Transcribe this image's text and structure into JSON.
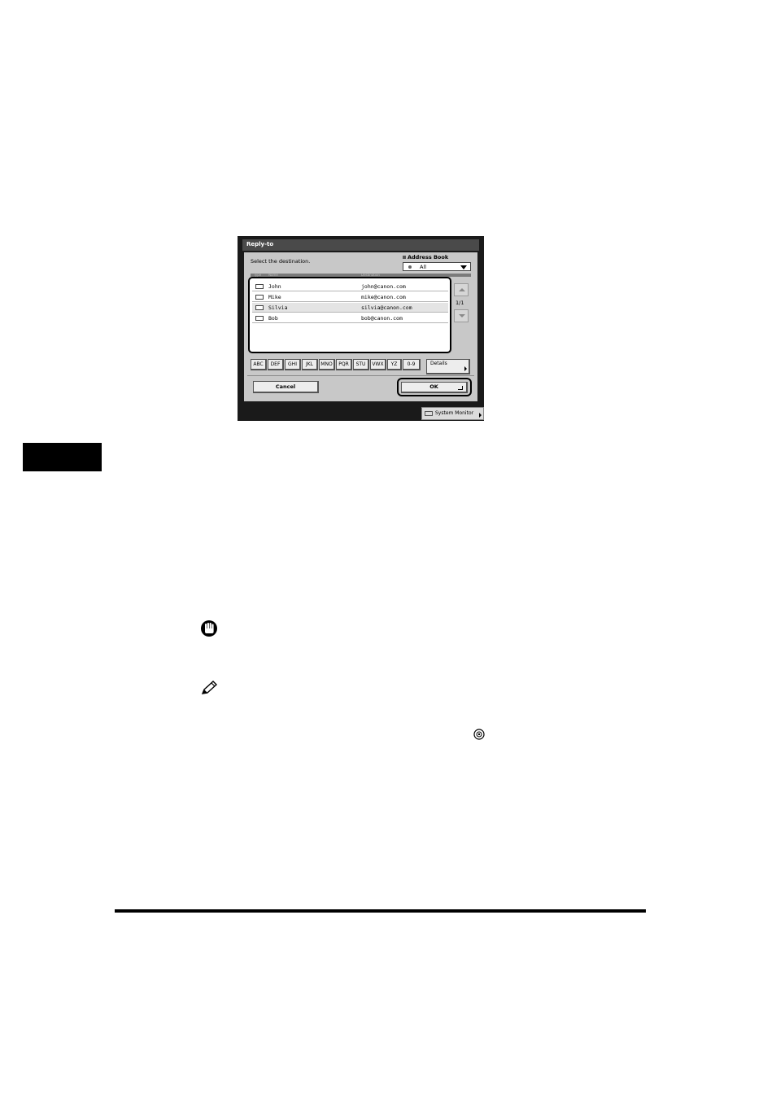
{
  "dialog": {
    "title": "Reply-to",
    "instruction": "Select the destination.",
    "address_book": {
      "label": "Address Book",
      "selected": "All"
    },
    "columns": {
      "type": "Type",
      "name": "Name",
      "destination": "Destination"
    },
    "entries": [
      {
        "name": "John",
        "address": "john@canon.com"
      },
      {
        "name": "Mike",
        "address": "mike@canon.com"
      },
      {
        "name": "Silvia",
        "address": "silvia@canon.com"
      },
      {
        "name": "Bob",
        "address": "bob@canon.com"
      }
    ],
    "page_indicator": "1/1",
    "alpha_buttons": [
      "ABC",
      "DEF",
      "GHI",
      "JKL",
      "MNO",
      "PQR",
      "STU",
      "VWX",
      "YZ",
      "0-9"
    ],
    "details_label": "Details",
    "cancel_label": "Cancel",
    "ok_label": "OK"
  },
  "footer": {
    "system_monitor_label": "System Monitor"
  },
  "icons": {
    "important": "hand-stop-icon",
    "note": "pencil-icon",
    "inline_key": "key-icon"
  }
}
